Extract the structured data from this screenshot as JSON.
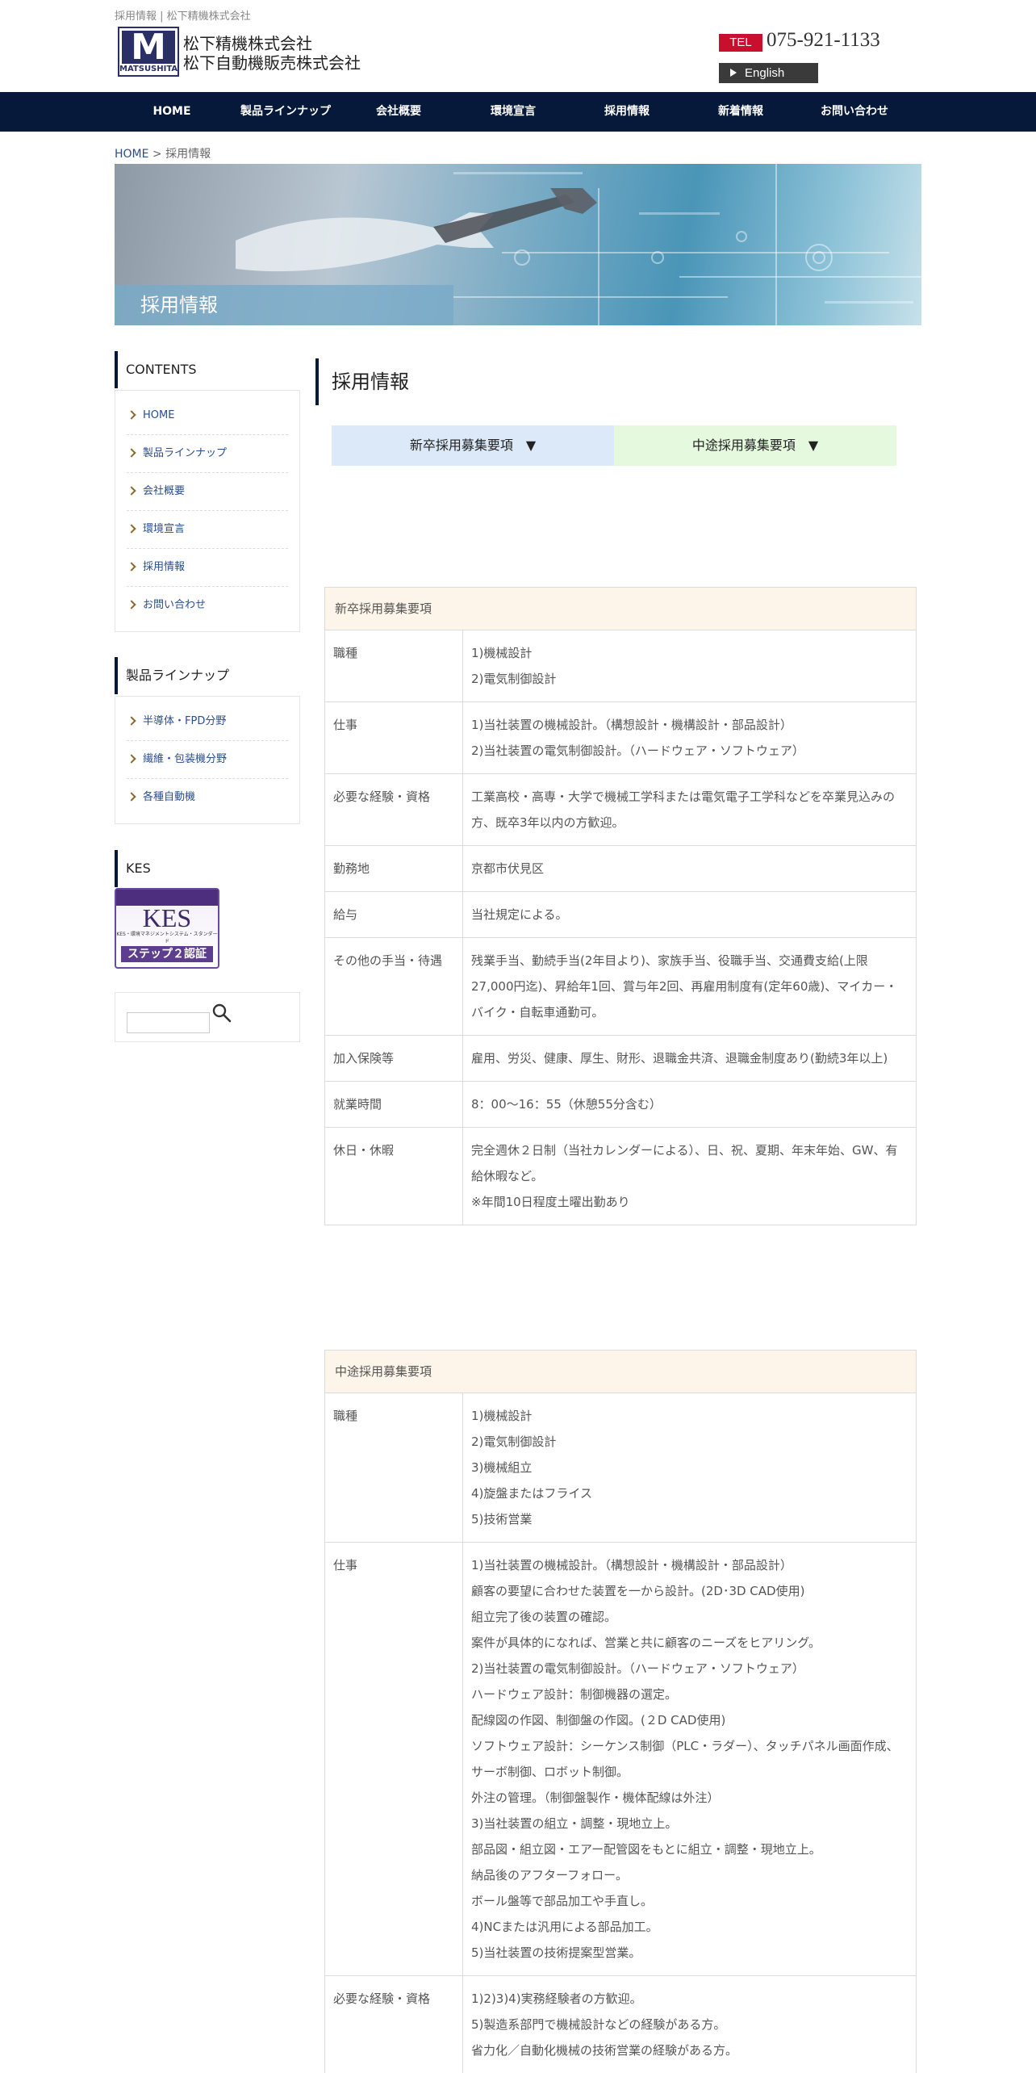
{
  "header": {
    "caption": "採用情報 | 松下精機株式会社",
    "logo_text": "MATSUSHITA",
    "logo_letter": "M",
    "company_1": "松下精機株式会社",
    "company_2": "松下自動機販売株式会社",
    "tel_label": "TEL",
    "tel_number": "075-921-1133",
    "english_label": "English"
  },
  "nav": [
    "HOME",
    "製品ラインナップ",
    "会社概要",
    "環境宣言",
    "採用情報",
    "新着情報",
    "お問い合わせ"
  ],
  "breadcrumb": {
    "home": "HOME",
    "sep": " > ",
    "current": "採用情報"
  },
  "hero_title": "採用情報",
  "sidebar": {
    "contents_title": "CONTENTS",
    "contents": [
      "HOME",
      "製品ラインナップ",
      "会社概要",
      "環境宣言",
      "採用情報",
      "お問い合わせ"
    ],
    "products_title": "製品ラインナップ",
    "products": [
      "半導体・FPD分野",
      "繊維・包装機分野",
      "各種自動機"
    ],
    "kes_title": "KES",
    "kes_badge": {
      "main": "KES",
      "sub": "KES・環境マネジメントシステム・スタンダード",
      "step": "ステップ２認証"
    }
  },
  "main": {
    "title": "採用情報",
    "tabs": [
      "新卒採用募集要項　▼",
      "中途採用募集要項　▼"
    ]
  },
  "new_grad": {
    "header": "新卒採用募集要項",
    "rows": [
      {
        "key": "職種",
        "lines": [
          "1)機械設計",
          "2)電気制御設計"
        ]
      },
      {
        "key": "仕事",
        "lines": [
          "1)当社装置の機械設計。（構想設計・機構設計・部品設計）",
          "2)当社装置の電気制御設計。（ハードウェア・ソフトウェア）"
        ]
      },
      {
        "key": "必要な経験・資格",
        "lines": [
          "工業高校・高専・大学で機械工学科または電気電子工学科などを卒業見込みの方、既卒3年以内の方歓迎。"
        ]
      },
      {
        "key": "勤務地",
        "lines": [
          "京都市伏見区"
        ]
      },
      {
        "key": "給与",
        "lines": [
          "当社規定による。"
        ]
      },
      {
        "key": "その他の手当・待遇",
        "lines": [
          "残業手当、勤続手当(2年目より)、家族手当、役職手当、交通費支給(上限27,000円迄)、昇給年1回、賞与年2回、再雇用制度有(定年60歳)、マイカー・バイク・自転車通勤可。"
        ]
      },
      {
        "key": "加入保険等",
        "lines": [
          "雇用、労災、健康、厚生、財形、退職金共済、退職金制度あり(勤続3年以上)"
        ]
      },
      {
        "key": "就業時間",
        "lines": [
          "8：00～16：55（休憩55分含む）"
        ]
      },
      {
        "key": "休日・休暇",
        "lines": [
          "完全週休２日制（当社カレンダーによる）、日、祝、夏期、年末年始、GW、有給休暇など。",
          "※年間10日程度土曜出勤あり"
        ]
      }
    ]
  },
  "mid_career": {
    "header": "中途採用募集要項",
    "rows": [
      {
        "key": "職種",
        "lines": [
          "1)機械設計",
          "2)電気制御設計",
          "3)機械組立",
          "4)旋盤またはフライス",
          "5)技術営業"
        ]
      },
      {
        "key": "仕事",
        "lines": [
          "1)当社装置の機械設計。（構想設計・機構設計・部品設計）",
          "顧客の要望に合わせた装置を一から設計。(2D･3D CAD使用)",
          "組立完了後の装置の確認。",
          "案件が具体的になれば、営業と共に顧客のニーズをヒアリング。",
          "2)当社装置の電気制御設計。（ハードウェア・ソフトウェア）",
          "ハードウェア設計：制御機器の選定。",
          "配線図の作図、制御盤の作図。(２D CAD使用)",
          "ソフトウェア設計：シーケンス制御（PLC・ラダー）、タッチパネル画面作成、サーボ制御、ロボット制御。",
          "外注の管理。（制御盤製作・機体配線は外注）",
          "3)当社装置の組立・調整・現地立上。",
          "部品図・組立図・エアー配管図をもとに組立・調整・現地立上。",
          "納品後のアフターフォロー。",
          "ボール盤等で部品加工や手直し。",
          "4)NCまたは汎用による部品加工。",
          "5)当社装置の技術提案型営業。"
        ]
      },
      {
        "key": "必要な経験・資格",
        "lines": [
          "1)2)3)4)実務経験者の方歓迎。",
          "5)製造系部門で機械設計などの経験がある方。",
          "省力化／自動化機械の技術営業の経験がある方。"
        ]
      }
    ]
  }
}
